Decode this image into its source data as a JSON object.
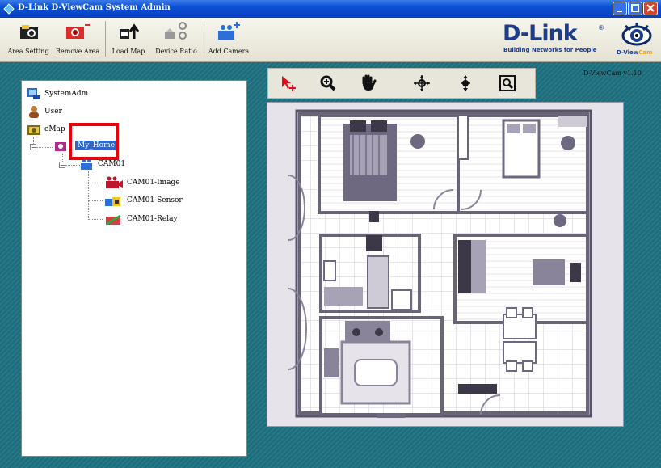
{
  "window": {
    "title": "D-Link D-ViewCam System Admin",
    "buttons": {
      "minimize": "–",
      "maximize": "□",
      "close": "✕"
    }
  },
  "toolbar": {
    "items": [
      {
        "label": "Area Setting",
        "icon": "camera-area-icon"
      },
      {
        "label": "Remove Area",
        "icon": "remove-area-icon"
      },
      {
        "label": "Load Map",
        "icon": "load-map-icon"
      },
      {
        "label": "Device Ratio",
        "icon": "device-ratio-icon"
      },
      {
        "label": "Add Camera",
        "icon": "add-camera-icon"
      }
    ]
  },
  "brand": {
    "name": "D-Link",
    "registered": "®",
    "tagline": "Building Networks for People",
    "product_d": "D-",
    "product_view": "View",
    "product_cam": "Cam"
  },
  "version": "D-ViewCam v1.10",
  "tree": {
    "items": [
      {
        "label": "SystemAdm",
        "icon": "system-admin-icon"
      },
      {
        "label": "User",
        "icon": "user-icon"
      },
      {
        "label": "eMap",
        "icon": "emap-icon"
      },
      {
        "label": "My_Home",
        "icon": "map-node-icon",
        "selected": true
      },
      {
        "label": "CAM01",
        "icon": "camera-group-icon"
      },
      {
        "label": "CAM01-Image",
        "icon": "camera-image-icon"
      },
      {
        "label": "CAM01-Sensor",
        "icon": "sensor-icon"
      },
      {
        "label": "CAM01-Relay",
        "icon": "relay-icon"
      }
    ],
    "expander_minus": "−"
  },
  "map_toolbar": {
    "tools": [
      "select-move-icon",
      "zoom-in-icon",
      "pan-hand-icon",
      "move-all-icon",
      "move-vertical-icon",
      "zoom-fit-icon"
    ]
  },
  "colors": {
    "title_bar": "#0a4fd6",
    "selection": "#3166c6",
    "highlight_box": "#e8000b",
    "background": "#1f6d7b",
    "brand": "#1d3d8a"
  }
}
